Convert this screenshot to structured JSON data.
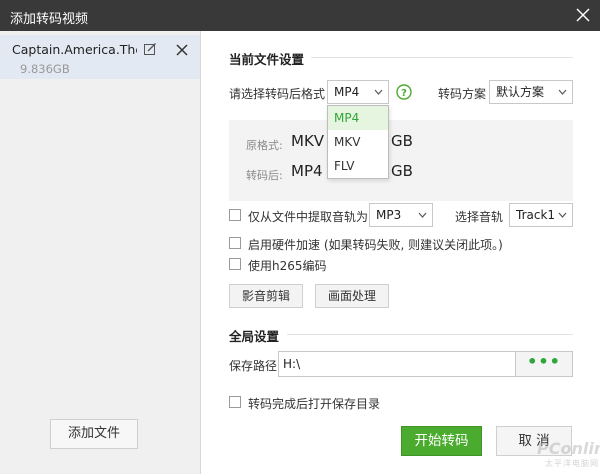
{
  "window": {
    "title": "添加转码视频"
  },
  "sidebar": {
    "file": {
      "name": "Captain.America.The...",
      "size": "9.836GB"
    },
    "add_file_label": "添加文件"
  },
  "current_settings": {
    "title": "当前文件设置",
    "format_label": "请选择转码后格式",
    "format_value": "MP4",
    "format_options": [
      "MP4",
      "MKV",
      "FLV"
    ],
    "scheme_label": "转码方案",
    "scheme_value": "默认方案",
    "original_label": "原格式:",
    "original_value": "MKV",
    "original_size": "GB",
    "after_label": "转码后:",
    "after_value": "MP4",
    "after_size": "GB",
    "extract_audio_label": "仅从文件中提取音轨为",
    "audio_format_value": "MP3",
    "track_label": "选择音轨",
    "track_value": "Track1",
    "hw_accel_label": "启用硬件加速 (如果转码失败, 则建议关闭此项。)",
    "h265_label": "使用h265编码",
    "video_edit_label": "影音剪辑",
    "image_process_label": "画面处理"
  },
  "global_settings": {
    "title": "全局设置",
    "save_path_label": "保存路径",
    "save_path_value": "H:\\",
    "browse_label": "•••",
    "open_dir_label": "转码完成后打开保存目录"
  },
  "actions": {
    "start_label": "开始转码",
    "cancel_label": "取 消"
  },
  "watermark": {
    "text": "PConline",
    "sub": "太平洋电脑网"
  },
  "colors": {
    "accent": "#4bab2f",
    "titlebar": "#393939",
    "selected_row": "#e2e9f3"
  }
}
